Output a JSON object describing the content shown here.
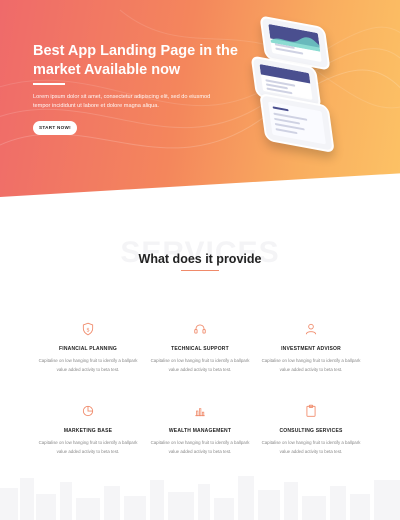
{
  "hero": {
    "title": "Best App Landing Page in the market Available now",
    "text": "Lorem ipsum dolor sit amet, consectetur adipiscing elit, sed do eiusmod tempor incididunt ut labore et dolore magna aliqua.",
    "button": "START NOW!"
  },
  "services": {
    "background_word": "SERVICES",
    "title": "What does it provide",
    "items": [
      {
        "name": "FINANCIAL PLANNING",
        "icon": "shield-dollar-icon",
        "desc": "Capitalise on low hanging fruit to identify a ballpark value added activity to beta test."
      },
      {
        "name": "TECHNICAL SUPPORT",
        "icon": "headset-icon",
        "desc": "Capitalise on low hanging fruit to identify a ballpark value added activity to beta test."
      },
      {
        "name": "INVESTMENT ADVISOR",
        "icon": "user-icon",
        "desc": "Capitalise on low hanging fruit to identify a ballpark value added activity to beta test."
      },
      {
        "name": "MARKETING BASE",
        "icon": "pie-chart-icon",
        "desc": "Capitalise on low hanging fruit to identify a ballpark value added activity to beta test."
      },
      {
        "name": "WEALTH MANAGEMENT",
        "icon": "bar-chart-icon",
        "desc": "Capitalise on low hanging fruit to identify a ballpark value added activity to beta test."
      },
      {
        "name": "CONSULTING SERVICES",
        "icon": "clipboard-icon",
        "desc": "Capitalise on low hanging fruit to identify a ballpark value added activity to beta test."
      }
    ]
  },
  "colors": {
    "gradient_start": "#ef6a6a",
    "gradient_end": "#fcc265",
    "accent": "#f08a6a"
  }
}
